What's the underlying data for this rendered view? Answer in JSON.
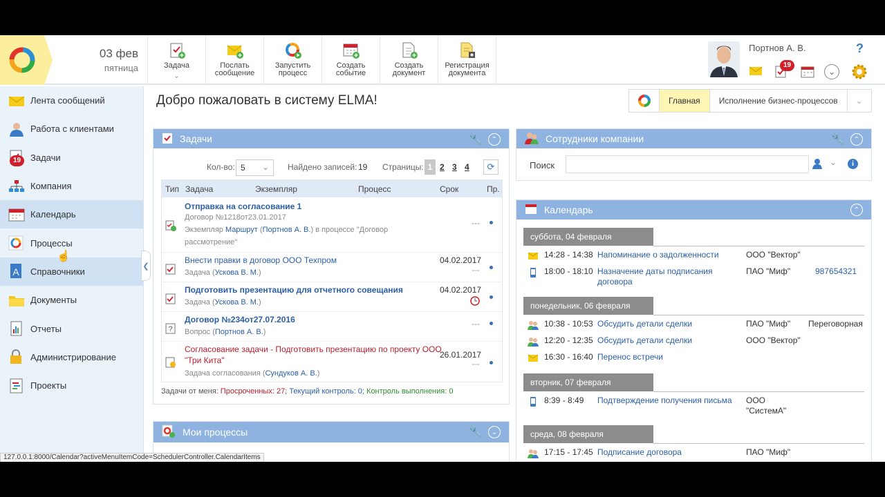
{
  "header": {
    "date": "03 фев",
    "weekday": "пятница",
    "toolbar": [
      {
        "line1": "Задача",
        "line2": ""
      },
      {
        "line1": "Послать",
        "line2": "сообщение"
      },
      {
        "line1": "Запустить",
        "line2": "процесс"
      },
      {
        "line1": "Создать",
        "line2": "событие"
      },
      {
        "line1": "Создать",
        "line2": "документ"
      },
      {
        "line1": "Регистрация",
        "line2": "документа"
      }
    ],
    "user_name": "Портнов А. В.",
    "task_badge": "19",
    "help": "?"
  },
  "sidebar": {
    "items": [
      {
        "label": "Лента сообщений"
      },
      {
        "label": "Работа с клиентами"
      },
      {
        "label": "Задачи",
        "badge": "19"
      },
      {
        "label": "Компания"
      },
      {
        "label": "Календарь"
      },
      {
        "label": "Процессы"
      },
      {
        "label": "Справочники"
      },
      {
        "label": "Документы"
      },
      {
        "label": "Отчеты"
      },
      {
        "label": "Администрирование"
      },
      {
        "label": "Проекты"
      }
    ]
  },
  "main": {
    "welcome": "Добро пожаловать в систему ELMA!",
    "tabs": [
      "Главная",
      "Исполнение бизнес-процессов"
    ]
  },
  "tasks": {
    "title": "Задачи",
    "count_label": "Кол-во:",
    "count_value": "5",
    "found_label": "Найдено записей:",
    "found_value": "19",
    "pages_label": "Страницы:",
    "pages": [
      "1",
      "2",
      "3",
      "4"
    ],
    "columns": [
      "Тип",
      "Задача",
      "Экземпляр",
      "Процесс",
      "Срок",
      "Пр."
    ],
    "rows": [
      {
        "title": "Отправка на согласование 1",
        "sub1": "Договор №1218от23.01.2017",
        "sub2_pre": "Экземпляр ",
        "sub2_link1": "Маршрут",
        "sub2_mid": " (",
        "sub2_link2": "Портнов А. В.",
        "sub2_post": ") в процессе \"Договор",
        "sub3": "рассмотрение\"",
        "date": "",
        "dash": "---"
      },
      {
        "title": "Внести правки в договор ООО Техпром",
        "sub1_pre": "Задача (",
        "sub1_link": "Ускова В. М.",
        "sub1_post": ")",
        "date": "04.02.2017",
        "dash": "---"
      },
      {
        "title": "Подготовить презентацию для отчетного совещания",
        "sub1_pre": "Задача (",
        "sub1_link": "Ускова В. М.",
        "sub1_post": ")",
        "date": "04.02.2017",
        "dash": ""
      },
      {
        "title": "Договор №234от27.07.2016",
        "sub1_pre": "Вопрос (",
        "sub1_link": "Портнов А. В.",
        "sub1_post": ")",
        "date": "",
        "dash": "---"
      },
      {
        "title": "Согласование задачи - Подготовить презентацию по проекту ООО",
        "title2": "\"Три Кита\"",
        "sub1_pre": "Задача согласования (",
        "sub1_link": "Сундуков А. В.",
        "sub1_post": ")",
        "date": "26.01.2017",
        "dash": "---"
      }
    ],
    "summary_label": "Задачи от меня:",
    "summary_overdue": "Просроченных: 27;",
    "summary_control": "Текущий контроль: 0;",
    "summary_exec": "Контроль выполнения: 0"
  },
  "processes": {
    "title": "Мои процессы"
  },
  "employees": {
    "title": "Сотрудники компании",
    "search_label": "Поиск",
    "search_value": ""
  },
  "calendar": {
    "title": "Календарь",
    "days": [
      {
        "label": "суббота, 04 февраля",
        "events": [
          {
            "time": "14:28 - 14:38",
            "name": "Напоминание о задолженности",
            "org": "ООО \"Вектор\"",
            "extra": ""
          },
          {
            "time": "18:00 - 18:10",
            "name": "Назначение даты подписания договора",
            "org": "ПАО \"Миф\"",
            "extra": "987654321"
          }
        ]
      },
      {
        "label": "понедельник, 06 февраля",
        "events": [
          {
            "time": "10:38 - 10:53",
            "name": "Обсудить детали сделки",
            "org": "ПАО \"Миф\"",
            "extra": "Переговорная"
          },
          {
            "time": "12:20 - 12:35",
            "name": "Обсудить детали сделки",
            "org": "ООО \"Вектор\"",
            "extra": ""
          },
          {
            "time": "16:30 - 16:40",
            "name": "Перенос встречи",
            "org": "",
            "extra": ""
          }
        ]
      },
      {
        "label": "вторник, 07 февраля",
        "events": [
          {
            "time": "8:39 - 8:49",
            "name": "Подтверждение получения письма",
            "org": "ООО \"СистемА\"",
            "extra": ""
          }
        ]
      },
      {
        "label": "среда, 08 февраля",
        "events": [
          {
            "time": "17:15 - 17:45",
            "name": "Подписание договора",
            "org": "ПАО \"Миф\"",
            "extra": ""
          }
        ]
      }
    ]
  },
  "statusbar": "127.0.0.1:8000/Calendar?activeMenuItemCode=SchedulerController.CalendarItems",
  "colors": {
    "panel_header": "#8fb3e0",
    "link": "#2b5fa8",
    "overdue": "#b6202e",
    "badge": "#d0202a",
    "active_tab": "#fdf5b4"
  }
}
